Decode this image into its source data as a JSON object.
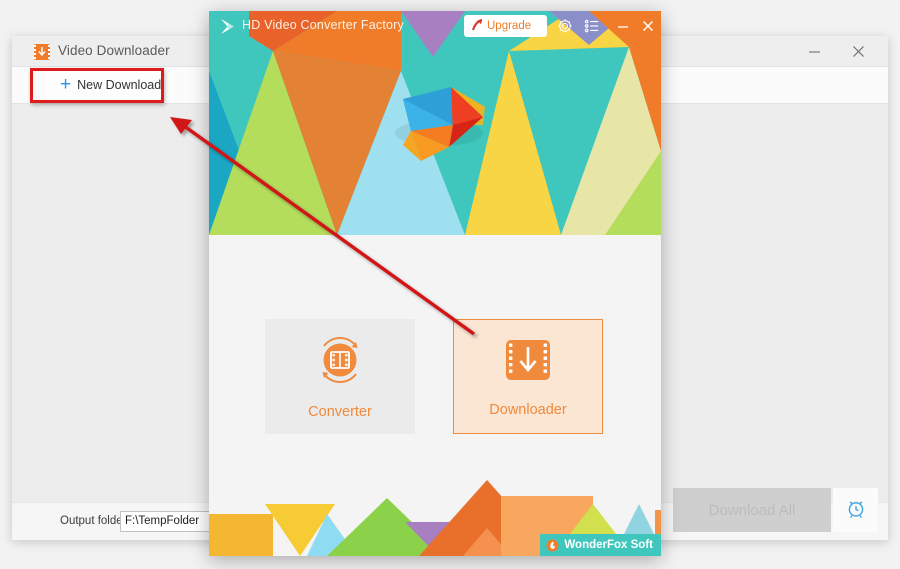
{
  "background_window": {
    "title": "Video Downloader",
    "title_icon": "download-film-icon",
    "minimize_label": "–",
    "close_label": "✕",
    "toolbar": {
      "new_download_label": "New Download",
      "plus_icon": "plus-icon"
    },
    "highlight_color": "#e01b1b",
    "footer": {
      "output_folder_label": "Output folder:",
      "output_folder_value": "F:\\TempFolder",
      "download_all_label": "Download All",
      "download_all_enabled": "false",
      "alarm_icon": "alarm-clock-icon",
      "alarm_color": "#46a6e0"
    }
  },
  "dialog": {
    "title": "HD Video Converter Factory",
    "logo_icon": "wonderfox-play-logo-icon",
    "titlebar": {
      "upgrade_label": "Upgrade",
      "upgrade_icon": "up-arrow-icon",
      "gear_icon": "gear-icon",
      "list_icon": "list-menu-icon",
      "minimize_label": "–",
      "close_label": "✕"
    },
    "banner": {
      "description": "colorful geometric triangle mosaic with 3D play-button logo",
      "background_color": "#3fc7bd"
    },
    "cards": [
      {
        "id": "converter",
        "label": "Converter",
        "icon": "film-convert-circle-icon",
        "selected": "false",
        "background": "#ebebeb"
      },
      {
        "id": "downloader",
        "label": "Downloader",
        "icon": "film-download-icon",
        "selected": "true",
        "background": "#fbe6d4",
        "border_color": "#ef8b3c"
      }
    ],
    "footer": {
      "brand_label": "WonderFox Soft",
      "brand_icon": "wonderfox-flame-icon",
      "brand_background": "#3fc7bd"
    },
    "accent_color": "#f08a3c"
  },
  "annotation": {
    "arrow_color": "#d01919",
    "arrow_from": "Downloader card",
    "arrow_to": "New Download button"
  }
}
